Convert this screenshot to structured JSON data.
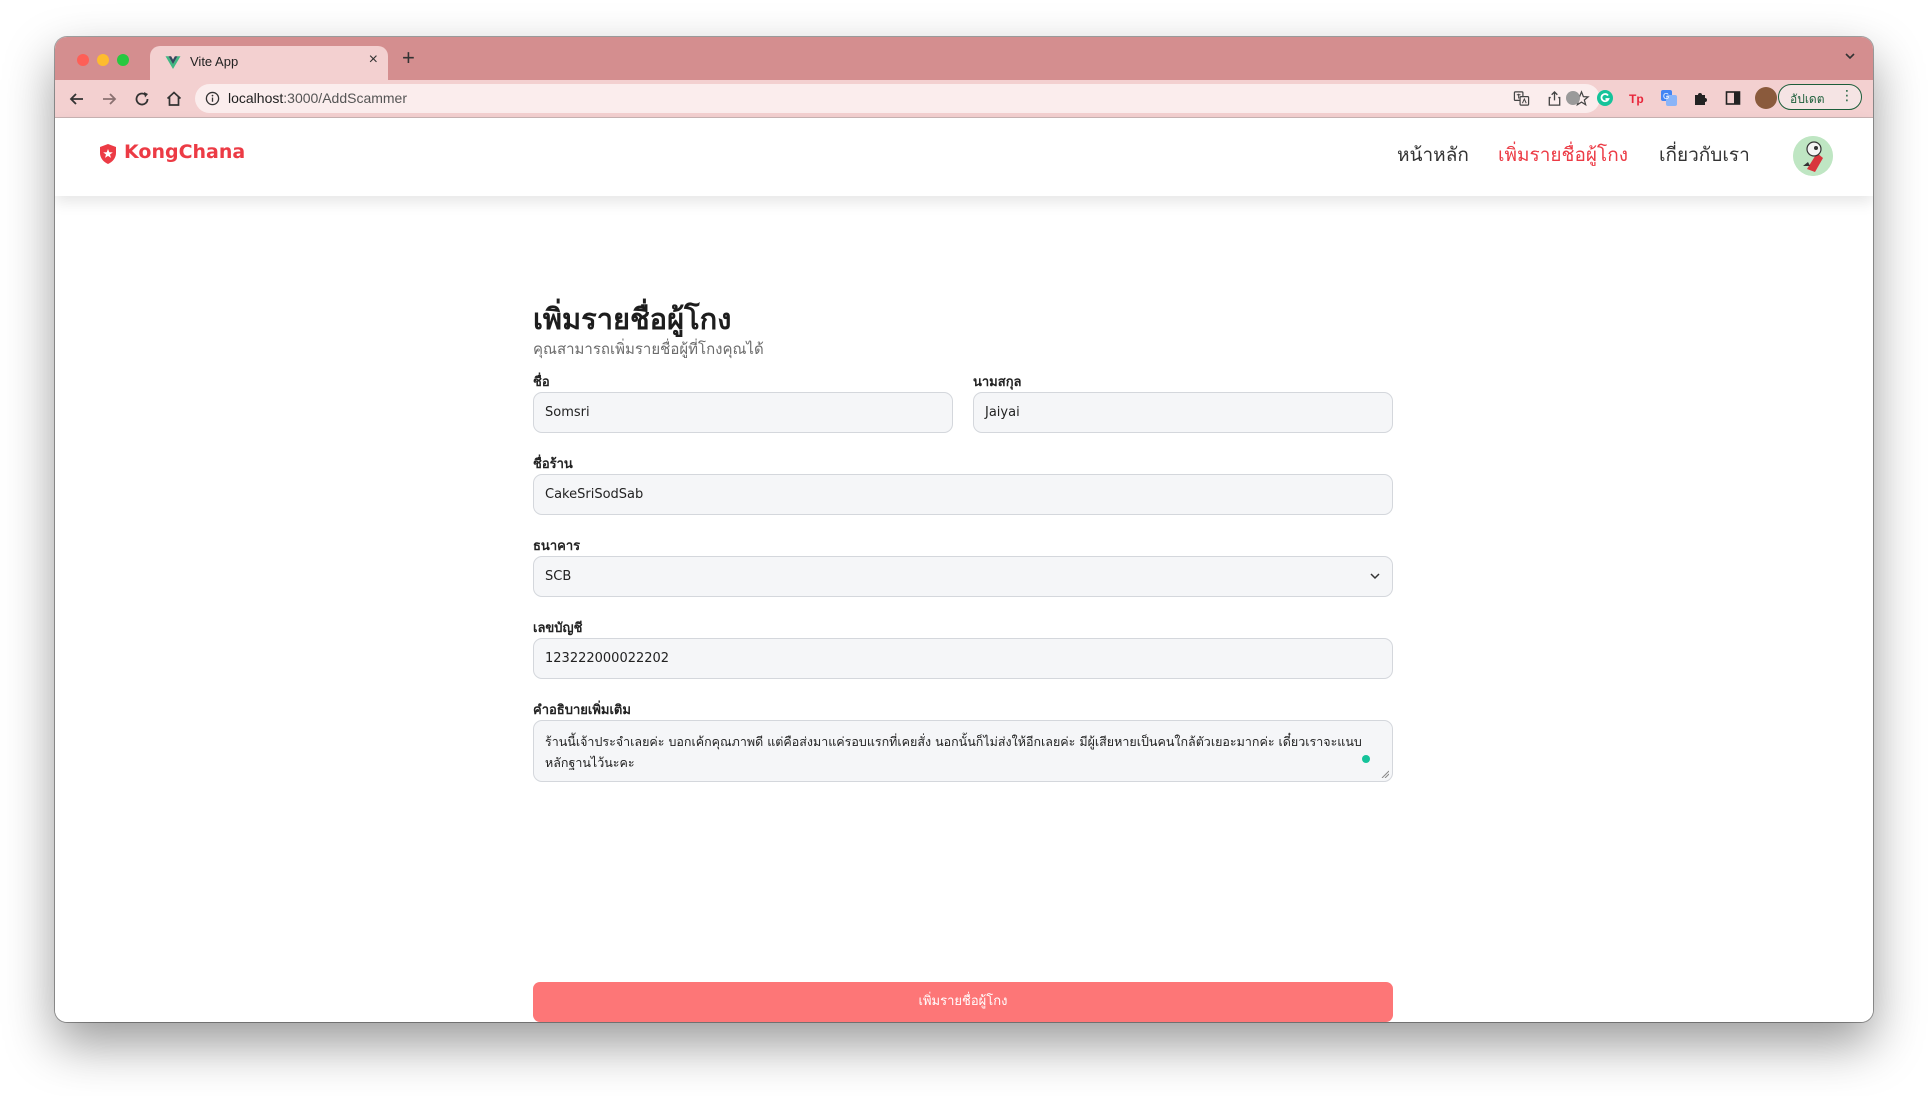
{
  "browser": {
    "tab_title": "Vite App",
    "tab_close": "×",
    "new_tab": "+",
    "url_host": "localhost",
    "url_rest": ":3000/AddScammer",
    "update_label": "อัปเดต",
    "update_menu": "⋮"
  },
  "app": {
    "brand": "KongChana",
    "nav": {
      "home": "หน้าหลัก",
      "add_scammer": "เพิ่มรายชื่อผู้โกง",
      "about": "เกี่ยวกับเรา"
    }
  },
  "form": {
    "title": "เพิ่มรายชื่อผู้โกง",
    "subtitle": "คุณสามารถเพิ่มรายชื่อผู้ที่โกงคุณได้",
    "first_name_label": "ชื่อ",
    "first_name_value": "Somsri",
    "last_name_label": "นามสกุล",
    "last_name_value": "Jaiyai",
    "shop_label": "ชื่อร้าน",
    "shop_value": "CakeSriSodSab",
    "bank_label": "ธนาคาร",
    "bank_value": "SCB",
    "account_label": "เลขบัญชี",
    "account_value": "123222000022202",
    "description_label": "คำอธิบายเพิ่มเติม",
    "description_value": "ร้านนี้เจ้าประจำเลยค่ะ บอกเค้กคุณภาพดี แต่คือส่งมาแค่รอบแรกที่เคยสั่ง นอกนั้นก็ไม่ส่งให้อีกเลยค่ะ มีผู้เสียหายเป็นคนใกล้ตัวเยอะมากค่ะ เดี๋ยวเราจะแนบหลักฐานไว้นะคะ",
    "submit_label": "เพิ่มรายชื่อผู้โกง"
  },
  "colors": {
    "accent": "#ec3b45",
    "submit_bg": "#fd7677",
    "tabstrip": "#d48e8f",
    "toolbar": "#f3d0d0"
  },
  "icons": [
    "vue-icon",
    "close-icon",
    "plus-icon",
    "chevron-down-icon",
    "back-icon",
    "forward-icon",
    "reload-icon",
    "home-icon",
    "info-icon",
    "translate-icon",
    "share-icon",
    "star-icon",
    "grammarly-icon",
    "puzzle-icon",
    "sidepanel-icon",
    "shield-star-icon",
    "avatar"
  ]
}
